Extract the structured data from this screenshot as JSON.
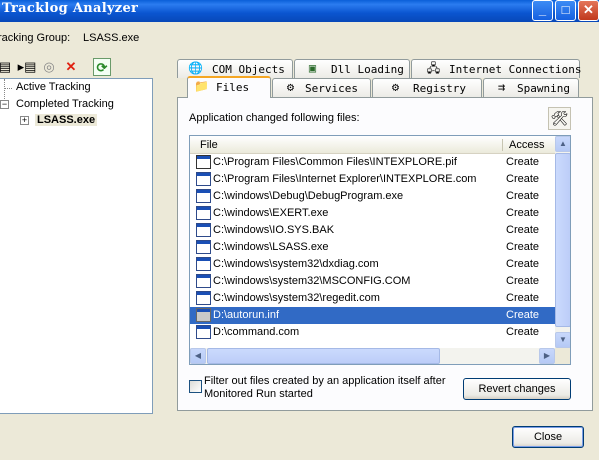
{
  "window": {
    "title": "Tracklog Analyzer",
    "controls": {
      "minimize": "_",
      "maximize": "□",
      "close": "✕"
    }
  },
  "tracking_group": {
    "label": "racking Group:",
    "value": "LSASS.exe"
  },
  "left_toolbar": [
    {
      "icon": "list-view-icon",
      "glyph": "▤"
    },
    {
      "icon": "expand-tree-icon",
      "glyph": "▸▤"
    },
    {
      "icon": "stop-icon",
      "glyph": "◎"
    },
    {
      "icon": "delete-icon",
      "glyph": "✕",
      "color": "#e02010"
    },
    {
      "icon": "refresh-icon",
      "glyph": "⟳",
      "color": "#2a8a2a"
    }
  ],
  "tree": {
    "active": "Active Tracking",
    "completed": "Completed Tracking",
    "child": "LSASS.exe"
  },
  "tabs_top": [
    {
      "label": "COM Objects",
      "icon": "com-objects-icon",
      "glyph": "🌐"
    },
    {
      "label": "Dll Loading",
      "icon": "dll-loading-icon",
      "glyph": "▣"
    },
    {
      "label": "Internet Connections",
      "icon": "internet-connections-icon",
      "glyph": "🖧"
    }
  ],
  "tabs_bottom": [
    {
      "label": "Files",
      "icon": "folder-icon",
      "glyph": "📁",
      "active": true
    },
    {
      "label": "Services",
      "icon": "services-icon",
      "glyph": "⚙"
    },
    {
      "label": "Registry",
      "icon": "registry-icon",
      "glyph": "⚙"
    },
    {
      "label": "Spawning",
      "icon": "spawning-icon",
      "glyph": "⇉"
    }
  ],
  "panel": {
    "label": "Application changed following files:",
    "tools_icon": "tools-icon"
  },
  "listview": {
    "columns": {
      "file": "File",
      "access": "Access"
    },
    "rows": [
      {
        "file": "C:\\Program Files\\Common Files\\INTEXPLORE.pif",
        "access": "Create"
      },
      {
        "file": "C:\\Program Files\\Internet Explorer\\INTEXPLORE.com",
        "access": "Create"
      },
      {
        "file": "C:\\windows\\Debug\\DebugProgram.exe",
        "access": "Create"
      },
      {
        "file": "C:\\windows\\EXERT.exe",
        "access": "Create"
      },
      {
        "file": "C:\\windows\\IO.SYS.BAK",
        "access": "Create"
      },
      {
        "file": "C:\\windows\\LSASS.exe",
        "access": "Create"
      },
      {
        "file": "C:\\windows\\system32\\dxdiag.com",
        "access": "Create"
      },
      {
        "file": "C:\\windows\\system32\\MSCONFIG.COM",
        "access": "Create"
      },
      {
        "file": "C:\\windows\\system32\\regedit.com",
        "access": "Create"
      },
      {
        "file": "D:\\autorun.inf",
        "access": "Create",
        "selected": true
      },
      {
        "file": "D:\\command.com",
        "access": "Create"
      }
    ]
  },
  "filter_checkbox": {
    "checked": false,
    "label": "Filter out files created by an application itself after Monitored Run started"
  },
  "buttons": {
    "revert": "Revert changes",
    "close": "Close"
  },
  "colors": {
    "titlebar": "#0a55d0",
    "selection": "#316ac5",
    "active_tab_accent": "#f5a623"
  }
}
